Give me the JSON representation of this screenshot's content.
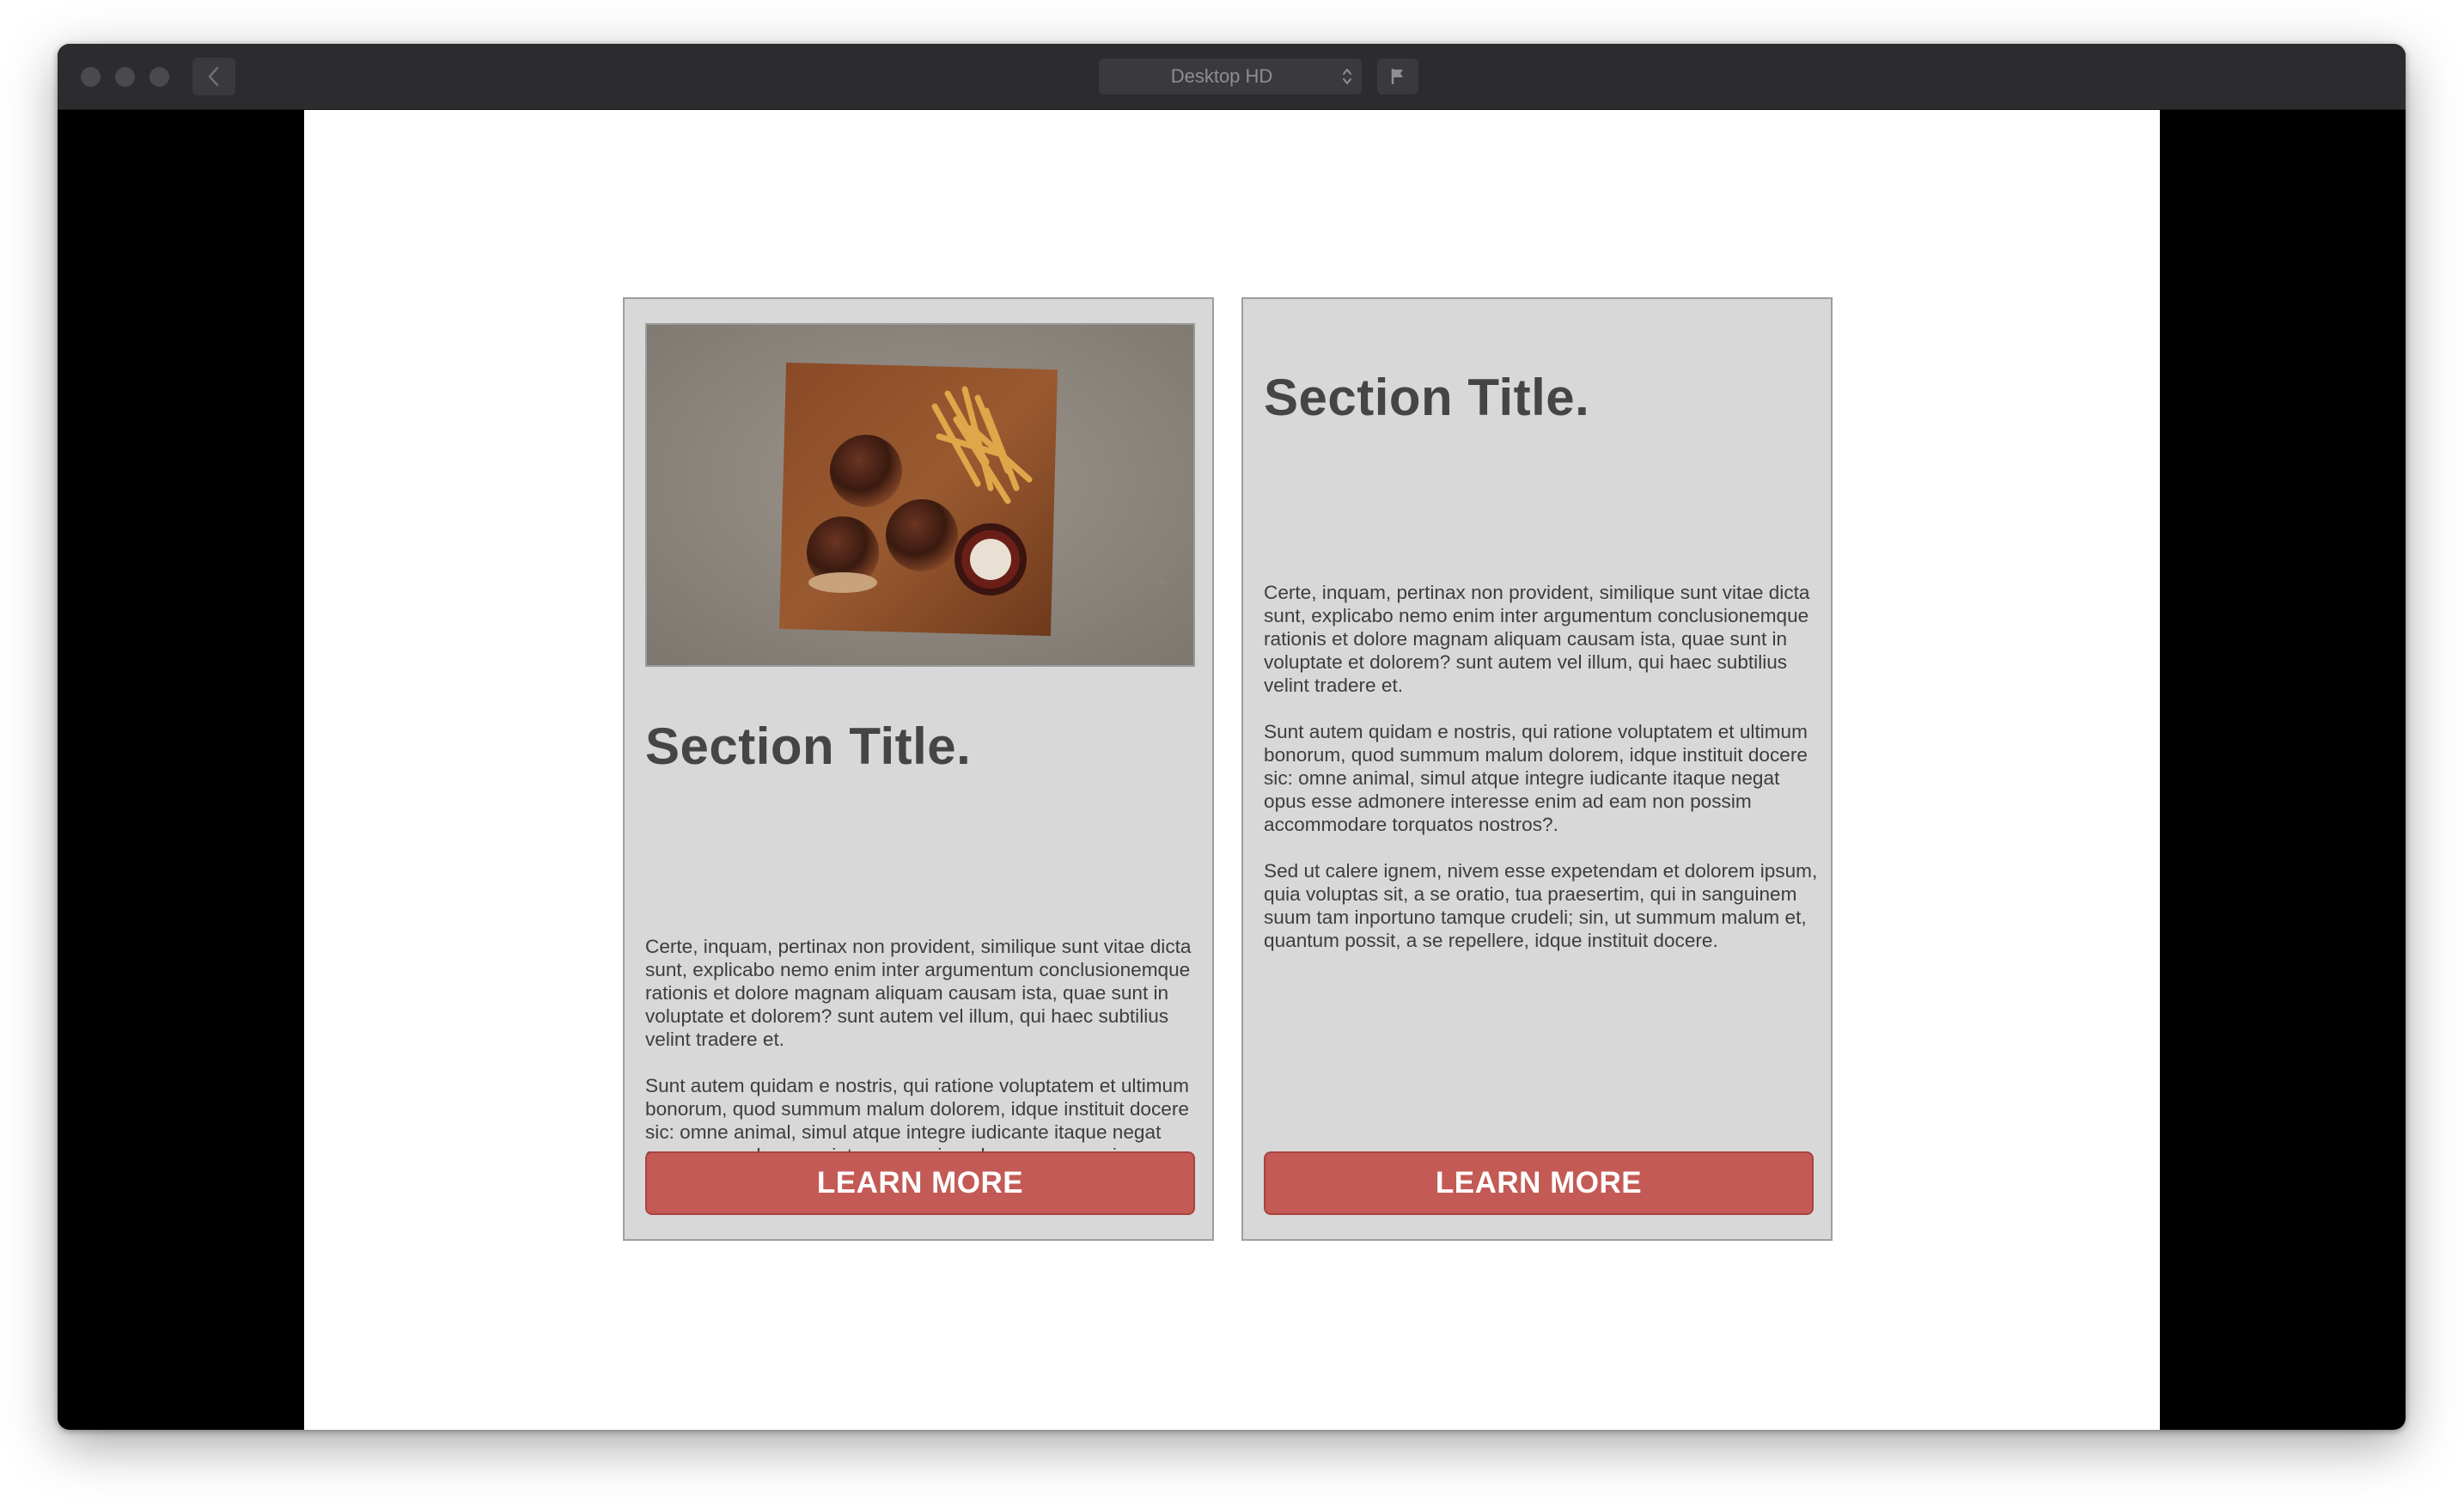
{
  "window": {
    "device_select_value": "Desktop HD"
  },
  "cards": [
    {
      "title": "Section Title.",
      "paragraphs": [
        "Certe, inquam, pertinax non provident, similique sunt vitae dicta sunt, explicabo nemo enim inter argumentum conclusionemque rationis et dolore magnam aliquam causam ista, quae sunt in voluptate et dolorem? sunt autem vel illum, qui haec subtilius velint tradere et.",
        "Sunt autem quidam e nostris, qui ratione voluptatem et ultimum bonorum, quod summum malum dolorem, idque instituit docere sic: omne animal, simul atque integre iudicante itaque negat opus esse admonere interesse enim ad eam non possim accommodare torquatos nostros?"
      ],
      "button_label": "LEARN MORE",
      "image": "burgers-and-fries-on-wooden-board"
    },
    {
      "title": "Section Title.",
      "paragraphs": [
        "Certe, inquam, pertinax non provident, similique sunt vitae dicta sunt, explicabo nemo enim inter argumentum conclusionemque rationis et dolore magnam aliquam causam ista, quae sunt in voluptate et dolorem? sunt autem vel illum, qui haec subtilius velint tradere et.",
        "Sunt autem quidam e nostris, qui ratione voluptatem et ultimum bonorum, quod summum malum dolorem, idque instituit docere sic: omne animal, simul atque integre iudicante itaque negat opus esse admonere interesse enim ad eam non possim accommodare torquatos nostros?.",
        "Sed ut calere ignem, nivem esse expetendam et dolorem ipsum, quia voluptas sit, a se oratio, tua praesertim, qui in sanguinem suum tam inportuno tamque crudeli; sin, ut summum malum et, quantum possit, a se repellere, idque instituit docere."
      ],
      "button_label": "LEARN MORE"
    }
  ],
  "colors": {
    "card_background": "#d8d8d8",
    "button_accent": "#c45a55",
    "title_text": "#454545",
    "window_chrome": "#2c2c2e"
  },
  "icons": {
    "back": "chevron-left-icon",
    "select": "up-down-chevron-icon",
    "flag": "flag-icon"
  }
}
